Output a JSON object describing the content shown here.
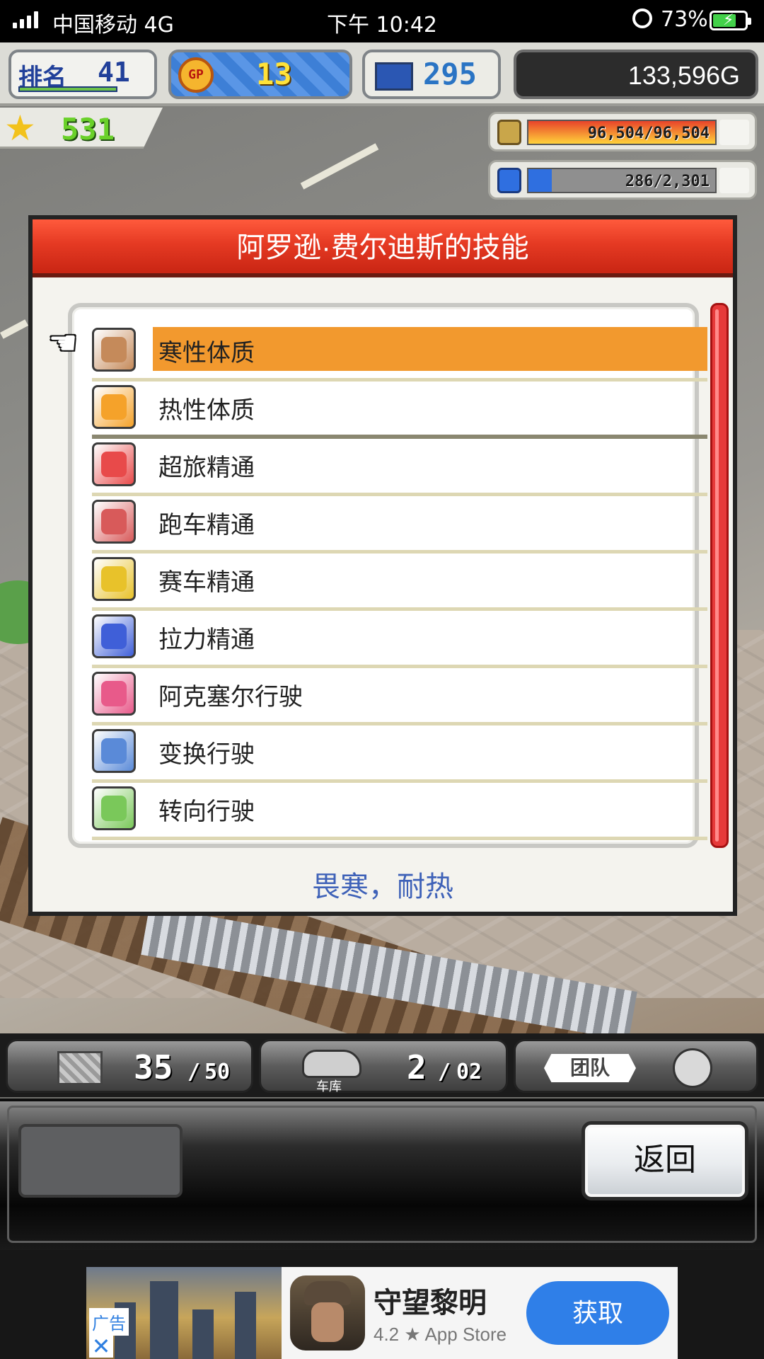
{
  "status_bar": {
    "carrier": "中国移动   4G",
    "time": "下午 10:42",
    "battery_percent": "73%",
    "battery_level": 0.73
  },
  "hud": {
    "rank_label": "排名",
    "rank_value": "41",
    "gp_label": "GP",
    "gp_value": "13",
    "pc_value": "295",
    "money": "133,596G",
    "stars": "531",
    "fuel": {
      "text": "96,504/96,504",
      "fraction": 1.0,
      "color": "#e8432a"
    },
    "energy": {
      "text": "286/2,301",
      "fraction": 0.124,
      "color": "#2f6fe0"
    }
  },
  "dialog": {
    "title": "阿罗逊·费尔迪斯的技能",
    "pointer_icon": "pointing-hand-icon",
    "skills": [
      {
        "label": "寒性体质",
        "icon": "cold-body-icon",
        "color": "#c58a5a",
        "selected": true
      },
      {
        "label": "热性体质",
        "icon": "hot-body-icon",
        "color": "#f5a22a",
        "selected": false
      },
      {
        "label": "超旅精通",
        "icon": "super-touring-icon",
        "color": "#e84a4a",
        "selected": false
      },
      {
        "label": "跑车精通",
        "icon": "sports-car-icon",
        "color": "#d85a5a",
        "selected": false
      },
      {
        "label": "赛车精通",
        "icon": "racing-car-icon",
        "color": "#e8c22a",
        "selected": false
      },
      {
        "label": "拉力精通",
        "icon": "rally-car-icon",
        "color": "#3f5fd8",
        "selected": false
      },
      {
        "label": "阿克塞尔行驶",
        "icon": "axel-drive-icon",
        "color": "#e85a8a",
        "selected": false
      },
      {
        "label": "变换行驶",
        "icon": "transform-drive-icon",
        "color": "#5a8ad8",
        "selected": false
      },
      {
        "label": "转向行驶",
        "icon": "steering-drive-icon",
        "color": "#7ac85a",
        "selected": false
      }
    ],
    "description": "畏寒，耐热"
  },
  "bottom_stats": {
    "parts_count": "35",
    "parts_max": "50",
    "garage_label": "车库",
    "garage_count": "2",
    "garage_max": "02",
    "team_label": "团队"
  },
  "controls": {
    "back_label": "返回"
  },
  "ad": {
    "tag": "广告",
    "close": "✕",
    "app_name": "守望黎明",
    "rating": "4.2 ★ App Store",
    "cta": "获取"
  }
}
